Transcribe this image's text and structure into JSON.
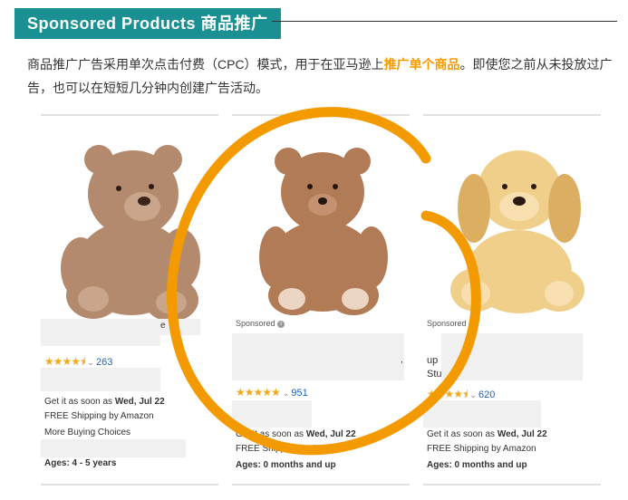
{
  "header": {
    "title": "Sponsored Products 商品推广"
  },
  "intro": {
    "part1": "商品推广广告采用单次点击付费（CPC）模式，用于在亚马逊上",
    "highlight": "推广单个商品",
    "part2": "。即使您之前从未投放过广告，也可以在短短几分钟内创建广告活动。"
  },
  "colors": {
    "header_bg": "#1a9092",
    "highlight": "#f39a00",
    "annotation_circle": "#f39a00",
    "star": "#f0a81c",
    "link": "#1f63b8"
  },
  "products": [
    {
      "image": "brown-teddy-bear",
      "title_fragment": "e",
      "rating": 4.5,
      "stars": "★★★★⯨",
      "review_count": "263",
      "delivery_prefix": "Get it as soon as ",
      "delivery_date": "Wed, Jul 22",
      "shipping": "FREE Shipping by Amazon",
      "more_choices": "More Buying Choices",
      "ages": "Ages: 4 - 5 years"
    },
    {
      "image": "light-brown-teddy-bear",
      "sponsored": "Sponsored",
      "title_fragment": ",",
      "rating": 5,
      "stars": "★★★★★",
      "review_count": "951",
      "delivery_prefix": "Get it as soon as ",
      "delivery_date": "Wed, Jul 22",
      "shipping": "FREE Shipping by Amazon",
      "ages": "Ages: 0 months and up"
    },
    {
      "image": "plush-puppy",
      "sponsored": "Sponsored",
      "title_fragment_1": "up",
      "title_fragment_2": "Stu",
      "rating": 4.5,
      "stars": "★★★★⯨",
      "review_count": "620",
      "delivery_prefix": "Get it as soon as ",
      "delivery_date": "Wed, Jul 22",
      "shipping": "FREE Shipping by Amazon",
      "ages": "Ages: 0 months and up"
    }
  ]
}
